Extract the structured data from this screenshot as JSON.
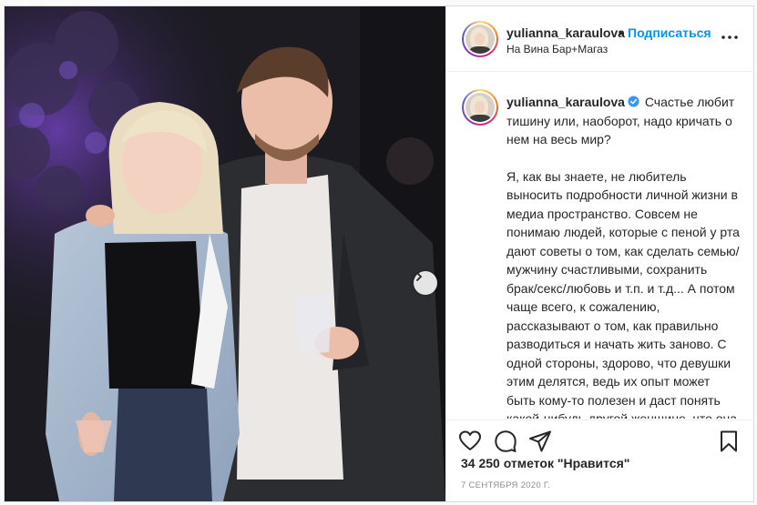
{
  "header": {
    "username": "yulianna_karaulova",
    "dot": "•",
    "follow_label": "Подписаться",
    "location": "На Вина Бар+Магаз"
  },
  "caption": {
    "username": "yulianna_karaulova",
    "paragraphs": [
      "Счастье любит тишину или, наоборот, надо кричать о нем на весь мир?",
      "Я, как вы знаете, не любитель выносить подробности личной жизни в медиа пространство. Совсем не понимаю людей, которые с пеной у рта дают советы о том, как сделать семью/мужчину счастливыми, сохранить брак/секс/любовь и т.п. и т.д... А потом чаще всего, к сожалению, рассказывают о том, как правильно разводиться и начать жить заново. С одной стороны, здорово, что девушки этим делятся, ведь их опыт может быть кому-то полезен и даст понять какой-нибудь другой женщине, что она не одна (я"
    ]
  },
  "likes_label": "34 250 отметок \"Нравится\"",
  "date_label": "7 СЕНТЯБРЯ 2020 Г.",
  "icons": {
    "like": "heart-outline",
    "comment": "speech-bubble",
    "share": "paper-plane",
    "save": "bookmark",
    "more": "three-dots",
    "next": "chevron-right",
    "verified": "blue-check-badge"
  },
  "colors": {
    "accent": "#0095f6",
    "text": "#262626",
    "muted": "#8e8e8e",
    "border": "#dbdbdb"
  }
}
